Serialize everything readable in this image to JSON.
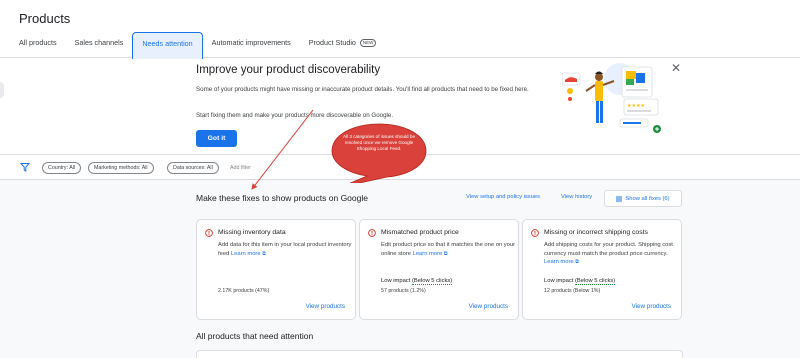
{
  "header": {
    "title": "Products",
    "tabs": [
      {
        "label": "All products"
      },
      {
        "label": "Sales channels"
      },
      {
        "label": "Needs attention"
      },
      {
        "label": "Automatic improvements"
      },
      {
        "label": "Product Studio",
        "badge": "NEW"
      }
    ]
  },
  "promo": {
    "title": "Improve your product discoverability",
    "description": "Some of your products might have missing or inaccurate product details. You'll find all products that need to be fixed here.",
    "description2": "Start fixing them and make your products more discoverable on Google.",
    "got_it": "Got it"
  },
  "filters": {
    "chips": [
      "Country: All",
      "Marketing methods: All",
      "Data sources: All"
    ],
    "add_filter": "Add filter"
  },
  "fixes": {
    "title": "Make these fixes to show products on Google",
    "view_setup": "View setup and policy issues",
    "view_history": "View history",
    "show_all": "Show all fixes (6)",
    "cards": [
      {
        "title": "Missing inventory data",
        "desc": "Add data for this item in your local product inventory feed",
        "learn_more": "Learn more",
        "impact_label": "",
        "impact_note": "",
        "count": "2.17K products (47%)",
        "view": "View products"
      },
      {
        "title": "Mismatched product price",
        "desc": "Edit product price so that it matches the one on your online store",
        "learn_more": "Learn more",
        "impact_label": "Low impact",
        "impact_note": "(Below 5 clicks)",
        "count": "57 products (1.2%)",
        "view": "View products"
      },
      {
        "title": "Missing or incorrect shipping costs",
        "desc": "Add shipping costs for your product. Shipping cost currency must match the product price currency.",
        "learn_more": "Learn more",
        "impact_label": "Low impact",
        "impact_note": "(Below 5 clicks)",
        "count": "12 products (Below 1%)",
        "view": "View products"
      }
    ]
  },
  "all_attention": {
    "title": "All products that need attention"
  },
  "annotation": {
    "text": "All 3 categories of issues should be resolved once we remove Google Shopping Local Feed."
  },
  "colors": {
    "accent": "#1a73e8",
    "error": "#d93025",
    "success": "#1e8e3e",
    "annotation": "#d9413a"
  },
  "icons": [
    "filter-icon",
    "close-icon",
    "error-icon",
    "open-in-new-icon",
    "list-icon"
  ]
}
